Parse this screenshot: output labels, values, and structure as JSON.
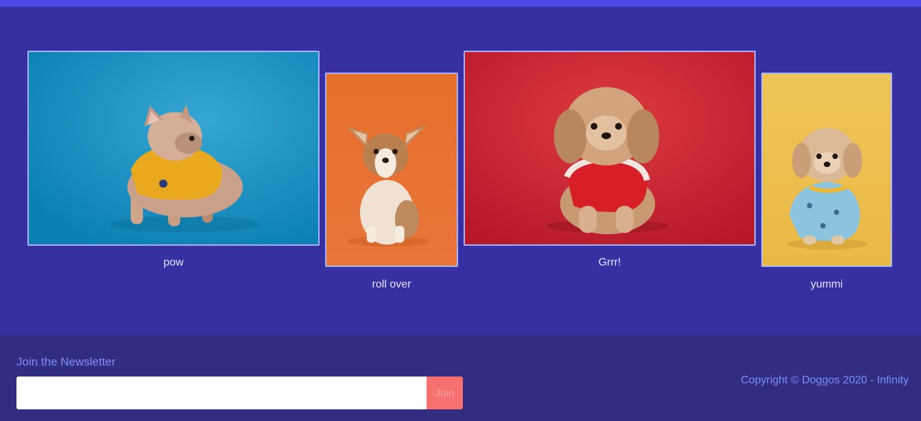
{
  "gallery": {
    "items": [
      {
        "caption": "pow",
        "background": "#1592c4",
        "shirt": "#e9a81d",
        "dog": "french-bulldog"
      },
      {
        "caption": "roll over",
        "background": "#e8702d",
        "shirt": "",
        "dog": "corgi-puppy"
      },
      {
        "caption": "Grrr!",
        "background": "#c91f2d",
        "shirt": "#d71f2a",
        "dog": "shih-tzu"
      },
      {
        "caption": "yummi",
        "background": "#efbf4c",
        "shirt": "#8cc3de",
        "dog": "poodle-mix"
      }
    ]
  },
  "footer": {
    "newsletter_title": "Join the Newsletter",
    "input_value": "",
    "join_label": "Join",
    "copyright": "Copyright © Doggos 2020 - Infinity"
  },
  "colors": {
    "top_bar": "#4f46e5",
    "gallery_bg": "#3730a3",
    "footer_bg": "#312e81",
    "accent_text": "#818cf8",
    "join_button": "#f87171"
  }
}
